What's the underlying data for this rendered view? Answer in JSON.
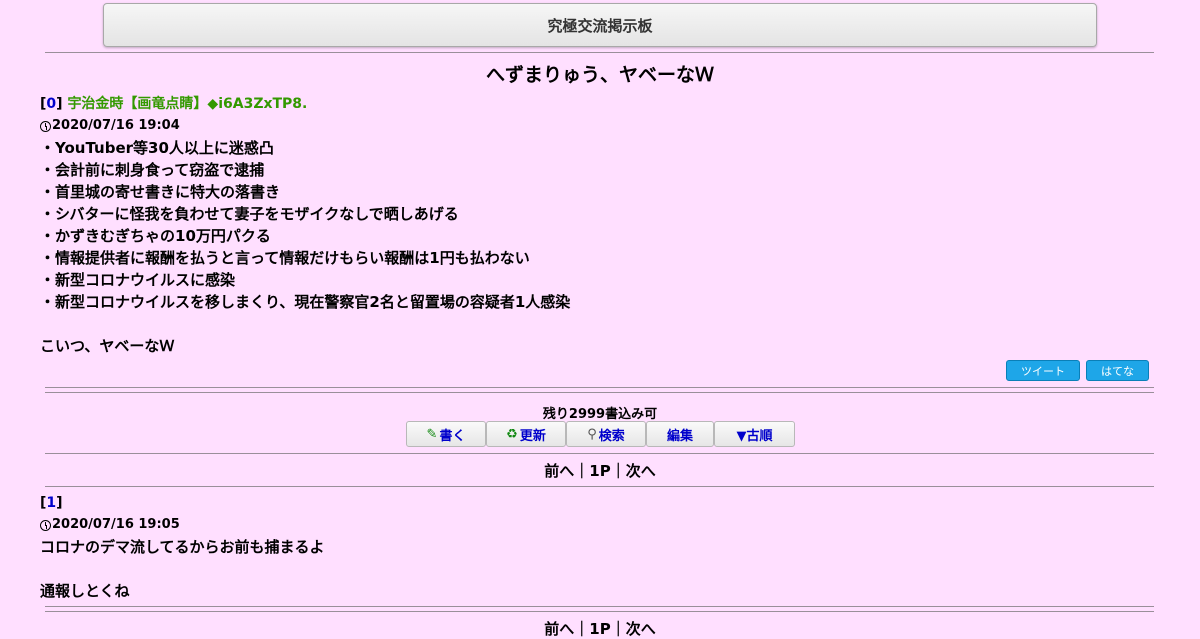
{
  "board": {
    "title": "究極交流掲示板"
  },
  "thread": {
    "title": "へずまりゅう、ヤベーなＷ"
  },
  "op": {
    "number": "0",
    "author": "宇治金時【画竜点睛】◆i6A3ZxTP8.",
    "date": "2020/07/16 19:04",
    "lines": [
      "・YouTuber等30人以上に迷惑凸",
      "・会計前に刺身食って窃盗で逮捕",
      "・首里城の寄せ書きに特大の落書き",
      "・シバターに怪我を負わせて妻子をモザイクなしで晒しあげる",
      "・かずきむぎちゃの10万円パクる",
      "・情報提供者に報酬を払うと言って情報だけもらい報酬は1円も払わない",
      "・新型コロナウイルスに感染",
      "・新型コロナウイルスを移しまくり、現在警察官2名と留置場の容疑者1人感染",
      "",
      "こいつ、ヤベーなＷ"
    ]
  },
  "share": {
    "tweet": "ツイート",
    "hatena": "はてな"
  },
  "remaining": "残り2999書込み可",
  "toolbar": {
    "write": "書く",
    "refresh": "更新",
    "search": "検索",
    "edit": "編集",
    "order": "▼古順"
  },
  "pager": {
    "prev": "前へ",
    "sep1": "｜",
    "page": "1P",
    "sep2": "｜",
    "next": "次へ"
  },
  "reply": {
    "number": "1",
    "date": "2020/07/16 19:05",
    "lines": [
      "コロナのデマ流してるからお前も捕まるよ",
      "",
      "通報しとくね"
    ]
  }
}
